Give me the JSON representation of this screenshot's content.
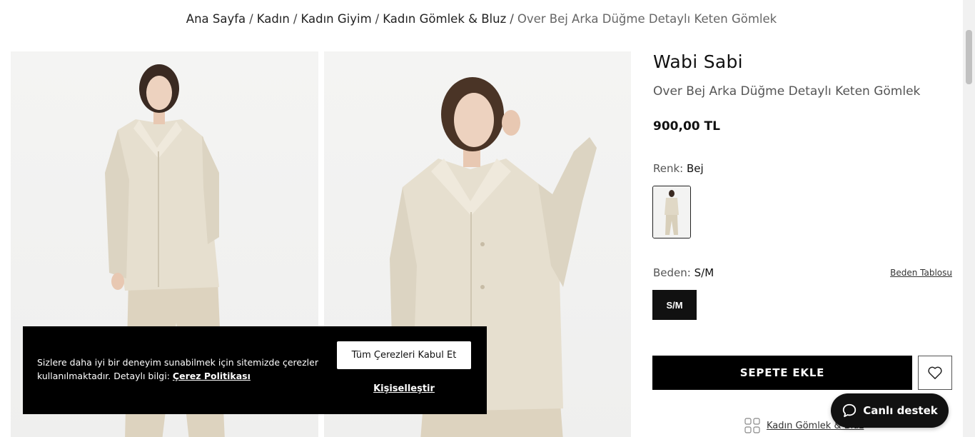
{
  "breadcrumb": {
    "items": [
      "Ana Sayfa",
      "Kadın",
      "Kadın Giyim",
      "Kadın Gömlek & Bluz"
    ],
    "current": "Over Bej Arka Düğme Detaylı Keten Gömlek",
    "separator": "/"
  },
  "product": {
    "brand": "Wabi Sabi",
    "name": "Over Bej Arka Düğme Detaylı Keten Gömlek",
    "price": "900,00 TL",
    "color_label": "Renk:",
    "color_value": "Bej",
    "size_label": "Beden:",
    "size_value": "S/M",
    "size_table_link": "Beden Tablosu",
    "sizes": [
      "S/M"
    ],
    "add_to_cart": "SEPETE EKLE",
    "category_link": "Kadın Gömlek & Bluz"
  },
  "cookie_banner": {
    "text": "Sizlere daha iyi bir deneyim sunabilmek için sitemizde çerezler kullanılmaktadır. Detaylı bilgi:",
    "policy_link": "Çerez Politikası",
    "accept_all": "Tüm Çerezleri Kabul Et",
    "customize": "Kişiselleştir"
  },
  "chat": {
    "label": "Canlı destek"
  },
  "colors": {
    "primary": "#000000",
    "shirt": "#e4dccb",
    "background": "#f2f2f1"
  },
  "icons": [
    "heart-icon",
    "chat-bubble-icon",
    "grid-icon"
  ]
}
